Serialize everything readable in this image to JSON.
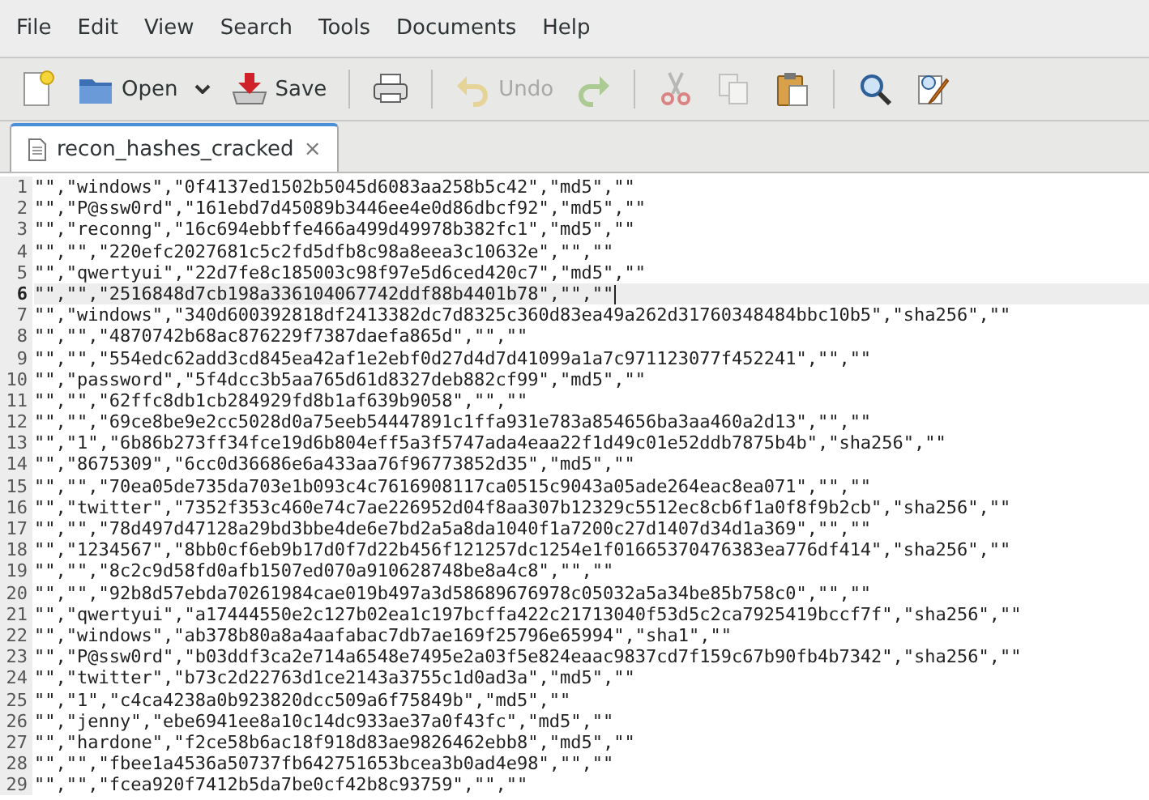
{
  "menu": [
    "File",
    "Edit",
    "View",
    "Search",
    "Tools",
    "Documents",
    "Help"
  ],
  "toolbar": {
    "groups": [
      [
        {
          "disabled": false,
          "dropdown": false
        },
        {
          "label": "Open",
          "disabled": false,
          "dropdown": true
        },
        {
          "label": "Save",
          "disabled": false,
          "dropdown": false
        }
      ],
      [
        {
          "disabled": false,
          "dropdown": false
        }
      ],
      [
        {
          "label": "Undo",
          "disabled": true,
          "dropdown": false
        },
        {
          "disabled": true,
          "dropdown": false
        }
      ],
      [
        {
          "disabled": true,
          "dropdown": false
        },
        {
          "disabled": true,
          "dropdown": false
        },
        {
          "disabled": false,
          "dropdown": false
        }
      ],
      [
        {
          "disabled": false,
          "dropdown": false
        },
        {
          "disabled": false,
          "dropdown": false
        }
      ]
    ]
  },
  "tabs": [
    {
      "label": "recon_hashes_cracked",
      "close": "×",
      "selected": true
    }
  ],
  "lines": [
    {
      "number": "1",
      "text": "\"\",\"windows\",\"0f4137ed1502b5045d6083aa258b5c42\",\"md5\",\"\"",
      "current": false
    },
    {
      "number": "2",
      "text": "\"\",\"P@ssw0rd\",\"161ebd7d45089b3446ee4e0d86dbcf92\",\"md5\",\"\"",
      "current": false
    },
    {
      "number": "3",
      "text": "\"\",\"reconng\",\"16c694ebbffe466a499d49978b382fc1\",\"md5\",\"\"",
      "current": false
    },
    {
      "number": "4",
      "text": "\"\",\"\",\"220efc2027681c5c2fd5dfb8c98a8eea3c10632e\",\"\",\"\"",
      "current": false
    },
    {
      "number": "5",
      "text": "\"\",\"qwertyui\",\"22d7fe8c185003c98f97e5d6ced420c7\",\"md5\",\"\"",
      "current": false
    },
    {
      "number": "6",
      "text": "\"\",\"\",\"2516848d7cb198a336104067742ddf88b4401b78\",\"\",\"\"",
      "current": true
    },
    {
      "number": "7",
      "text": "\"\",\"windows\",\"340d600392818df2413382dc7d8325c360d83ea49a262d31760348484bbc10b5\",\"sha256\",\"\"",
      "current": false
    },
    {
      "number": "8",
      "text": "\"\",\"\",\"4870742b68ac876229f7387daefa865d\",\"\",\"\"",
      "current": false
    },
    {
      "number": "9",
      "text": "\"\",\"\",\"554edc62add3cd845ea42af1e2ebf0d27d4d7d41099a1a7c971123077f452241\",\"\",\"\"",
      "current": false
    },
    {
      "number": "10",
      "text": "\"\",\"password\",\"5f4dcc3b5aa765d61d8327deb882cf99\",\"md5\",\"\"",
      "current": false
    },
    {
      "number": "11",
      "text": "\"\",\"\",\"62ffc8db1cb284929fd8b1af639b9058\",\"\",\"\"",
      "current": false
    },
    {
      "number": "12",
      "text": "\"\",\"\",\"69ce8be9e2cc5028d0a75eeb54447891c1ffa931e783a854656ba3aa460a2d13\",\"\",\"\"",
      "current": false
    },
    {
      "number": "13",
      "text": "\"\",\"1\",\"6b86b273ff34fce19d6b804eff5a3f5747ada4eaa22f1d49c01e52ddb7875b4b\",\"sha256\",\"\"",
      "current": false
    },
    {
      "number": "14",
      "text": "\"\",\"8675309\",\"6cc0d36686e6a433aa76f96773852d35\",\"md5\",\"\"",
      "current": false
    },
    {
      "number": "15",
      "text": "\"\",\"\",\"70ea05de735da703e1b093c4c7616908117ca0515c9043a05ade264eac8ea071\",\"\",\"\"",
      "current": false
    },
    {
      "number": "16",
      "text": "\"\",\"twitter\",\"7352f353c460e74c7ae226952d04f8aa307b12329c5512ec8cb6f1a0f8f9b2cb\",\"sha256\",\"\"",
      "current": false
    },
    {
      "number": "17",
      "text": "\"\",\"\",\"78d497d47128a29bd3bbe4de6e7bd2a5a8da1040f1a7200c27d1407d34d1a369\",\"\",\"\"",
      "current": false
    },
    {
      "number": "18",
      "text": "\"\",\"1234567\",\"8bb0cf6eb9b17d0f7d22b456f121257dc1254e1f01665370476383ea776df414\",\"sha256\",\"\"",
      "current": false
    },
    {
      "number": "19",
      "text": "\"\",\"\",\"8c2c9d58fd0afb1507ed070a910628748be8a4c8\",\"\",\"\"",
      "current": false
    },
    {
      "number": "20",
      "text": "\"\",\"\",\"92b8d57ebda70261984cae019b497a3d58689676978c05032a5a34be85b758c0\",\"\",\"\"",
      "current": false
    },
    {
      "number": "21",
      "text": "\"\",\"qwertyui\",\"a17444550e2c127b02ea1c197bcffa422c21713040f53d5c2ca7925419bccf7f\",\"sha256\",\"\"",
      "current": false
    },
    {
      "number": "22",
      "text": "\"\",\"windows\",\"ab378b80a8a4aafabac7db7ae169f25796e65994\",\"sha1\",\"\"",
      "current": false
    },
    {
      "number": "23",
      "text": "\"\",\"P@ssw0rd\",\"b03ddf3ca2e714a6548e7495e2a03f5e824eaac9837cd7f159c67b90fb4b7342\",\"sha256\",\"\"",
      "current": false
    },
    {
      "number": "24",
      "text": "\"\",\"twitter\",\"b73c2d22763d1ce2143a3755c1d0ad3a\",\"md5\",\"\"",
      "current": false
    },
    {
      "number": "25",
      "text": "\"\",\"1\",\"c4ca4238a0b923820dcc509a6f75849b\",\"md5\",\"\"",
      "current": false
    },
    {
      "number": "26",
      "text": "\"\",\"jenny\",\"ebe6941ee8a10c14dc933ae37a0f43fc\",\"md5\",\"\"",
      "current": false
    },
    {
      "number": "27",
      "text": "\"\",\"hardone\",\"f2ce58b6ac18f918d83ae9826462ebb8\",\"md5\",\"\"",
      "current": false
    },
    {
      "number": "28",
      "text": "\"\",\"\",\"fbee1a4536a50737fb642751653bcea3b0ad4e98\",\"\",\"\"",
      "current": false
    },
    {
      "number": "29",
      "text": "\"\",\"\",\"fcea920f7412b5da7be0cf42b8c93759\",\"\",\"\"",
      "current": false
    }
  ]
}
